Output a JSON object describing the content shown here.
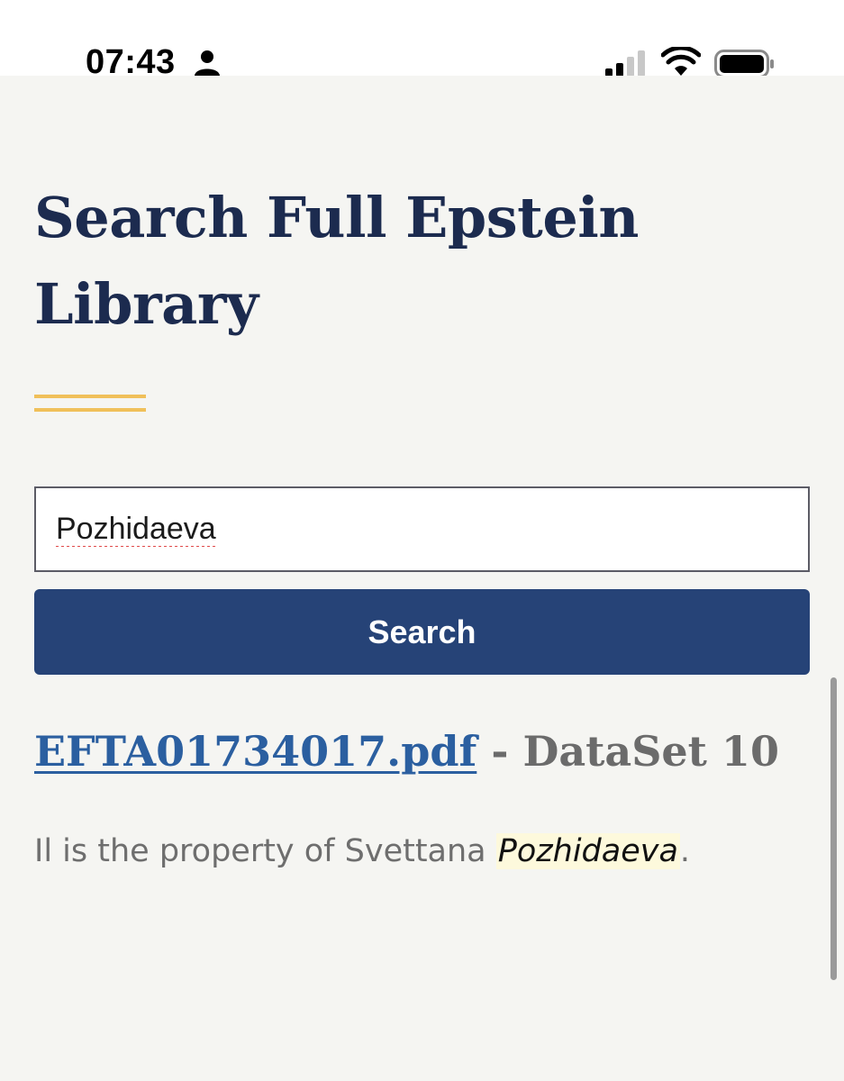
{
  "status_bar": {
    "time": "07:43",
    "icons": [
      "person-icon",
      "signal-icon",
      "wifi-icon",
      "battery-icon"
    ]
  },
  "page": {
    "title": "Search Full Epstein Library",
    "accent_color": "#f0c05a",
    "title_color": "#1c2b4f"
  },
  "search": {
    "input_value": "Pozhidaeva",
    "button_label": "Search",
    "button_color": "#264377"
  },
  "results": [
    {
      "filename": "EFTA01734017.pdf",
      "separator": " - ",
      "dataset": "DataSet 10",
      "snippet_before": "Il is the property of Svettana ",
      "snippet_highlight": "Pozhidaeva",
      "snippet_after": "."
    }
  ]
}
